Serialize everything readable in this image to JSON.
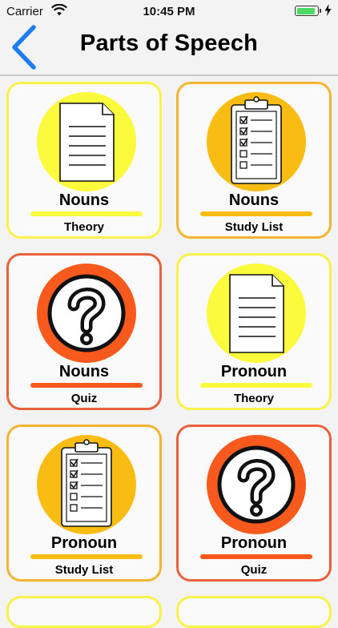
{
  "status_bar": {
    "carrier": "Carrier",
    "time": "10:45 PM",
    "battery_level": 0.92,
    "icons": [
      "wifi-icon",
      "battery-icon",
      "charging-bolt-icon"
    ]
  },
  "nav": {
    "title": "Parts of Speech",
    "back_icon": "chevron-left-icon"
  },
  "colors": {
    "accent_blue": "#1e7cf2",
    "yellow": "#fbfa3c",
    "amber": "#f9bc12",
    "orange": "#f85a1e",
    "border_yellow": "#f8f24a",
    "border_amber": "#f1b531",
    "border_orange": "#e8613a"
  },
  "cards": [
    {
      "title": "Nouns",
      "subtitle": "Theory",
      "icon": "document-icon",
      "theme": "yellow"
    },
    {
      "title": "Nouns",
      "subtitle": "Study List",
      "icon": "clipboard-checklist-icon",
      "theme": "amber"
    },
    {
      "title": "Nouns",
      "subtitle": "Quiz",
      "icon": "question-mark-icon",
      "theme": "orange"
    },
    {
      "title": "Pronoun",
      "subtitle": "Theory",
      "icon": "document-icon",
      "theme": "yellow"
    },
    {
      "title": "Pronoun",
      "subtitle": "Study List",
      "icon": "clipboard-checklist-icon",
      "theme": "amber"
    },
    {
      "title": "Pronoun",
      "subtitle": "Quiz",
      "icon": "question-mark-icon",
      "theme": "orange"
    }
  ]
}
